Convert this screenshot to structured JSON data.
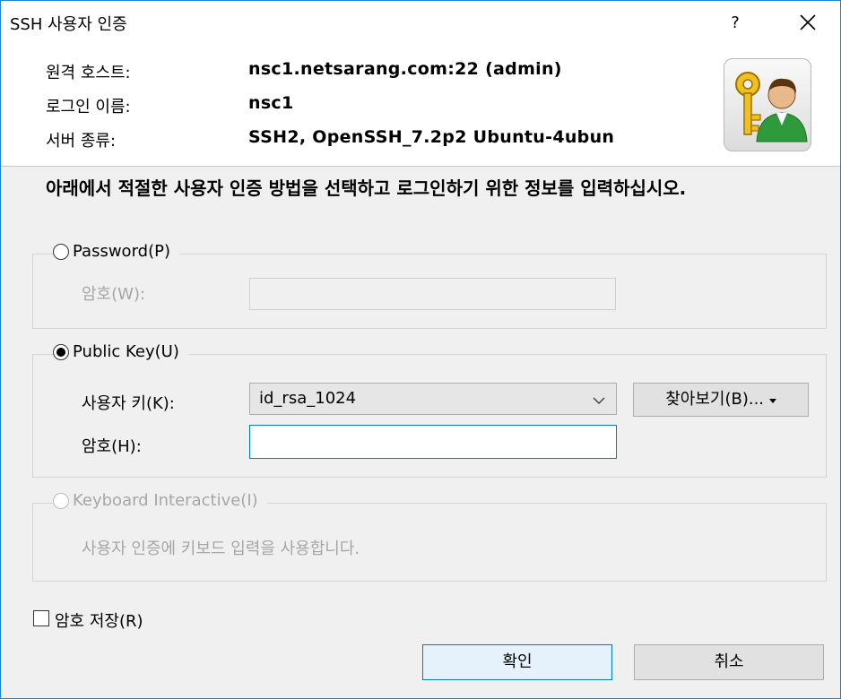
{
  "window": {
    "title": "SSH 사용자 인증",
    "help_label": "?"
  },
  "header": {
    "host_label": "원격 호스트:",
    "host_value": "nsc1.netsarang.com:22 (admin)",
    "login_label": "로그인 이름:",
    "login_value": "nsc1",
    "server_label": "서버 종류:",
    "server_value": "SSH2, OpenSSH_7.2p2 Ubuntu-4ubun"
  },
  "instruction": "아래에서 적절한 사용자 인증 방법을 선택하고 로그인하기 위한 정보를 입력하십시오.",
  "password_group": {
    "label": "Password(P)",
    "selected": false,
    "password_label": "암호(W):",
    "password_value": ""
  },
  "publickey_group": {
    "label": "Public Key(U)",
    "selected": true,
    "userkey_label": "사용자 키(K):",
    "userkey_value": "id_rsa_1024",
    "browse_label": "찾아보기(B)...",
    "passphrase_label": "암호(H):",
    "passphrase_value": ""
  },
  "keyboard_group": {
    "label": "Keyboard Interactive(I)",
    "selected": false,
    "description": "사용자 인증에 키보드 입력을 사용합니다."
  },
  "save_password": {
    "label": "암호 저장(R)",
    "checked": false
  },
  "buttons": {
    "ok": "확인",
    "cancel": "취소"
  },
  "colors": {
    "accent": "#0078d7",
    "border": "#1883d7",
    "disabled_text": "#a6a6a6"
  }
}
